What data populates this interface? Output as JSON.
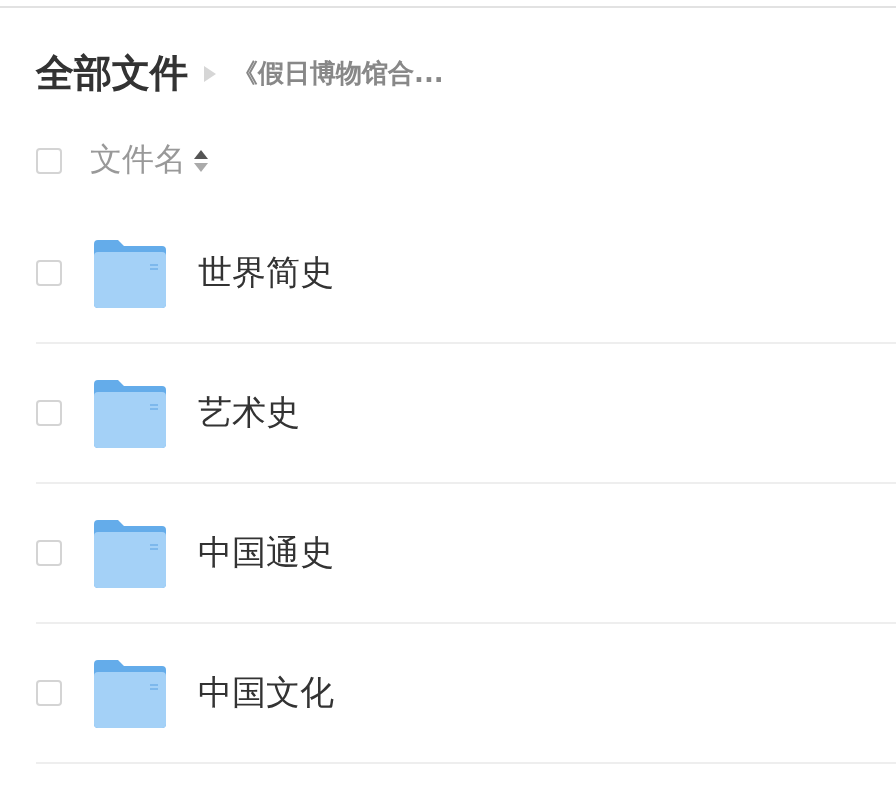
{
  "breadcrumb": {
    "root": "全部文件",
    "current": "《假日博物馆合..."
  },
  "header": {
    "checked": false,
    "column": "文件名"
  },
  "files": [
    {
      "name": "世界简史",
      "checked": false
    },
    {
      "name": "艺术史",
      "checked": false
    },
    {
      "name": "中国通史",
      "checked": false
    },
    {
      "name": "中国文化",
      "checked": false
    }
  ]
}
